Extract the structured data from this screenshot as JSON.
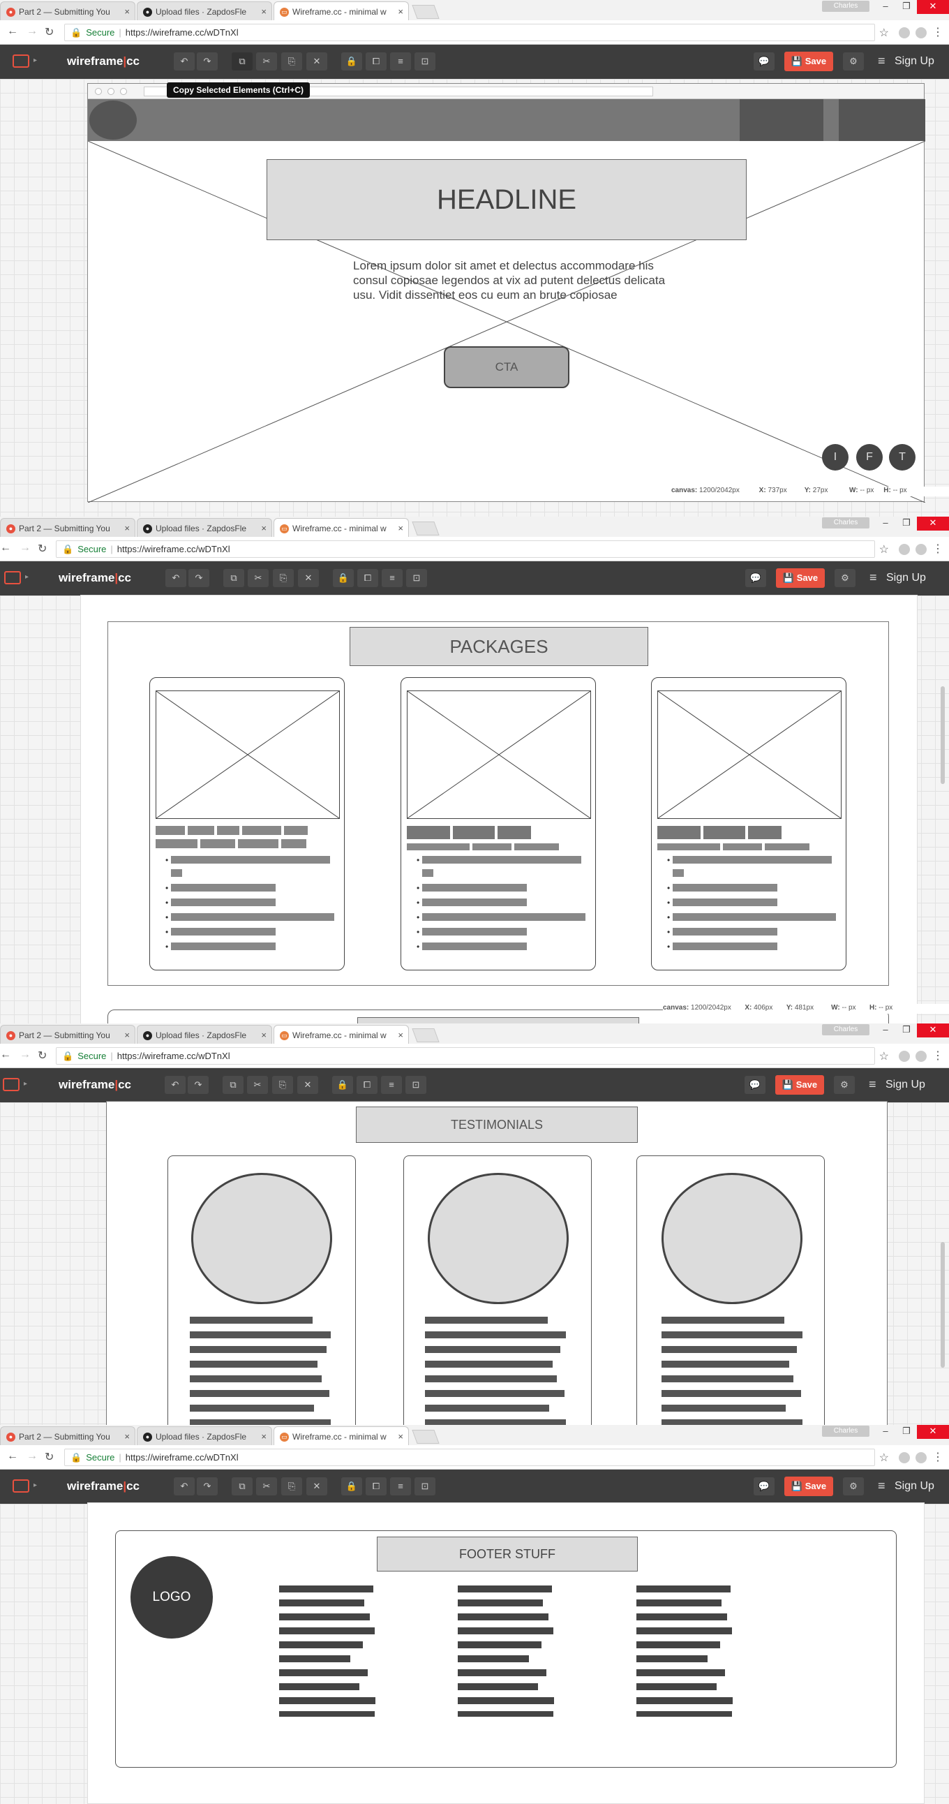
{
  "tabs": [
    {
      "label": "Part 2 — Submitting You",
      "favicon": "app-icon",
      "color": "#e8513f"
    },
    {
      "label": "Upload files · ZapdosFle",
      "favicon": "github-icon",
      "color": "#222222"
    },
    {
      "label": "Wireframe.cc - minimal w",
      "favicon": "wireframe-icon",
      "color": "#e8803f"
    }
  ],
  "profile_name": "Charles",
  "address": {
    "secure_label": "Secure",
    "url": "https://wireframe.cc/wDTnXl"
  },
  "toolbar": {
    "brand_main": "wireframe",
    "brand_pipe": "|",
    "brand_cc": "cc",
    "save_label": "Save",
    "signup_label": "Sign Up"
  },
  "tooltip": "Copy Selected Elements (Ctrl+C)",
  "status1": {
    "canvas": "canvas:",
    "canvas_value": "1200/2042px",
    "x": "X:",
    "x_value": "737px",
    "y": "Y:",
    "y_value": "27px",
    "w": "W:",
    "w_value": "-- px",
    "h": "H:",
    "h_value": "-- px"
  },
  "status2": {
    "canvas": "canvas:",
    "canvas_value": "1200/2042px",
    "x": "X:",
    "x_value": "406px",
    "y": "Y:",
    "y_value": "481px",
    "w": "W:",
    "w_value": "-- px",
    "h": "H:",
    "h_value": "-- px"
  },
  "hero": {
    "headline": "HEADLINE",
    "body": "Lorem ipsum dolor sit amet et delectus accommodare his consul copiosae legendos at vix ad putent delectus delicata usu. Vidit dissentiet eos cu eum an brute copiosae",
    "cta": "CTA",
    "social": [
      "I",
      "F",
      "T"
    ]
  },
  "packages": {
    "title": "PACKAGES"
  },
  "testimonials": {
    "title": "TESTIMONIALS"
  },
  "footer": {
    "title": "FOOTER STUFF",
    "logo": "LOGO"
  },
  "colors": {
    "brand_accent": "#e8513f",
    "toolbar_bg": "#3d3d3d",
    "close_button": "#e81123"
  }
}
